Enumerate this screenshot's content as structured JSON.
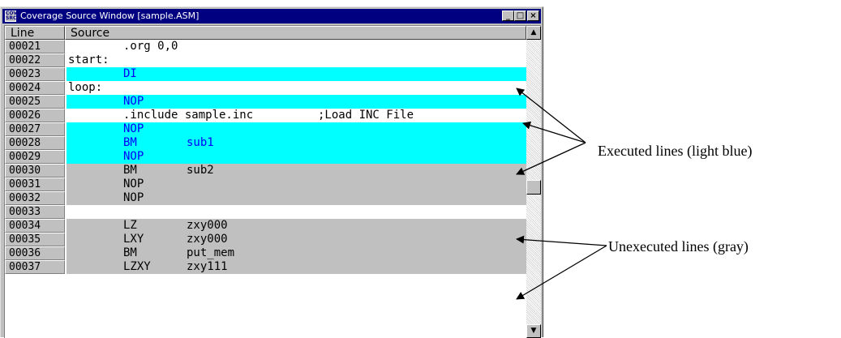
{
  "window": {
    "app_icon_text": "COV\nSRC",
    "title": "Coverage Source Window [sample.ASM]",
    "minimize_glyph": "_",
    "maximize_glyph": "□",
    "close_glyph": "×"
  },
  "table": {
    "headers": {
      "line": "Line",
      "source": "Source"
    },
    "rows": [
      {
        "line": "00021",
        "state": "plain",
        "label": "",
        "op": ".org 0,0",
        "arg": "",
        "comment": ""
      },
      {
        "line": "00022",
        "state": "plain",
        "label": "start:",
        "op": "",
        "arg": "",
        "comment": ""
      },
      {
        "line": "00023",
        "state": "exec",
        "label": "",
        "op": "DI",
        "arg": "",
        "comment": ""
      },
      {
        "line": "00024",
        "state": "plain",
        "label": "loop:",
        "op": "",
        "arg": "",
        "comment": ""
      },
      {
        "line": "00025",
        "state": "exec",
        "label": "",
        "op": "NOP",
        "arg": "",
        "comment": ""
      },
      {
        "line": "00026",
        "state": "plain",
        "label": "",
        "op": ".include sample.inc",
        "arg": "",
        "comment": ";Load INC File"
      },
      {
        "line": "00027",
        "state": "exec",
        "label": "",
        "op": "NOP",
        "arg": "",
        "comment": ""
      },
      {
        "line": "00028",
        "state": "exec",
        "label": "",
        "op": "BM",
        "arg": "sub1",
        "comment": ""
      },
      {
        "line": "00029",
        "state": "exec",
        "label": "",
        "op": "NOP",
        "arg": "",
        "comment": ""
      },
      {
        "line": "00030",
        "state": "unexec",
        "label": "",
        "op": "BM",
        "arg": "sub2",
        "comment": ""
      },
      {
        "line": "00031",
        "state": "unexec",
        "label": "",
        "op": "NOP",
        "arg": "",
        "comment": ""
      },
      {
        "line": "00032",
        "state": "unexec",
        "label": "",
        "op": "NOP",
        "arg": "",
        "comment": ""
      },
      {
        "line": "00033",
        "state": "plain",
        "label": "",
        "op": "",
        "arg": "",
        "comment": ""
      },
      {
        "line": "00034",
        "state": "unexec",
        "label": "",
        "op": "LZ",
        "arg": "zxy000",
        "comment": ""
      },
      {
        "line": "00035",
        "state": "unexec",
        "label": "",
        "op": "LXY",
        "arg": "zxy000",
        "comment": ""
      },
      {
        "line": "00036",
        "state": "unexec",
        "label": "",
        "op": "BM",
        "arg": "put_mem",
        "comment": ""
      },
      {
        "line": "00037",
        "state": "unexec",
        "label": "",
        "op": "LZXY",
        "arg": "zxy111",
        "comment": ""
      }
    ]
  },
  "scrollbar": {
    "up_glyph": "▲",
    "down_glyph": "▼"
  },
  "annotations": {
    "executed": "Executed lines (light blue)",
    "unexecuted": "Unexecuted lines (gray)"
  },
  "colors": {
    "executed_bg": "#00ffff",
    "executed_text": "#0000ff",
    "unexecuted_bg": "#c0c0c0",
    "titlebar": "#000080"
  }
}
